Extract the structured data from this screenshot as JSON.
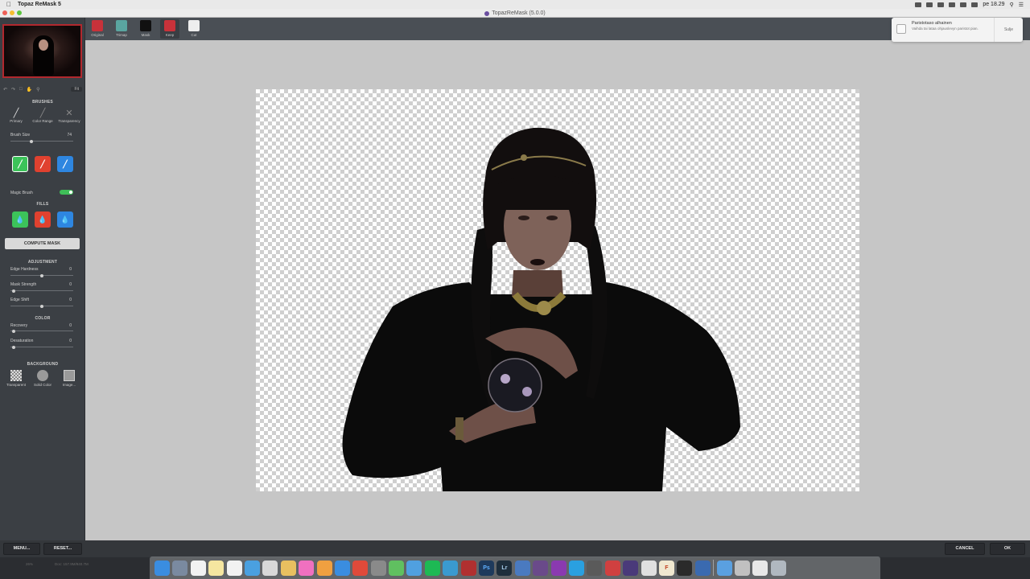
{
  "app": {
    "menu_name": "Topaz ReMask 5",
    "window_title": "TopazReMask (5.0.0)",
    "clock": "pe 18.29"
  },
  "views": [
    {
      "label": "Original",
      "color": "#c8323a"
    },
    {
      "label": "Trimap",
      "color": "#5aa5a0"
    },
    {
      "label": "Mask",
      "color": "#111111"
    },
    {
      "label": "Keep",
      "color": "#c8323a"
    },
    {
      "label": "Cut",
      "color": "#eeeeee"
    }
  ],
  "nav": {
    "fit_label": "Fit"
  },
  "brushes": {
    "heading": "BRUSHES",
    "tools": [
      "Primary",
      "Color Range",
      "Transparency"
    ],
    "size_label": "Brush Size",
    "size_value": "74",
    "size_fraction": 0.33,
    "color_buttons": [
      "#3cc35a",
      "#e0412f",
      "#2e86e0"
    ],
    "magic_label": "Magic Brush",
    "magic_on": true
  },
  "fills": {
    "heading": "FILLS",
    "buttons": [
      "#3cc35a",
      "#e0412f",
      "#2e86e0"
    ]
  },
  "compute_label": "COMPUTE MASK",
  "adjustment": {
    "heading": "ADJUSTMENT",
    "edge_hardness": {
      "label": "Edge Hardness",
      "value": "0",
      "fraction": 0.5
    },
    "mask_strength": {
      "label": "Mask Strength",
      "value": "0",
      "fraction": 0.05
    },
    "edge_shift": {
      "label": "Edge Shift",
      "value": "0",
      "fraction": 0.5
    }
  },
  "color": {
    "heading": "COLOR",
    "recovery": {
      "label": "Recovery",
      "value": "0",
      "fraction": 0.05
    },
    "desaturation": {
      "label": "Desaturation",
      "value": "0",
      "fraction": 0.05
    }
  },
  "background": {
    "heading": "BACKGROUND",
    "options": [
      "Transparent",
      "Solid Color",
      "Image..."
    ]
  },
  "notification": {
    "title": "Paristotaso alhainen",
    "body": "Vaihda tai lataa ohjauslevyn paristot pian.",
    "close": "Sulje"
  },
  "buttons": {
    "menu": "MENU...",
    "reset": "RESET...",
    "cancel": "CANCEL",
    "ok": "OK"
  },
  "status": {
    "zoom": "26%",
    "doc": "Doc: 157.9M/940.7M"
  },
  "dock_icons": [
    "finder-icon",
    "launchpad-icon",
    "calendar-icon",
    "notes-icon",
    "reminders-icon",
    "safari-icon",
    "mail-icon",
    "photos-icon",
    "itunes-icon",
    "books-icon",
    "appstore-icon",
    "chrome-icon",
    "system-prefs-icon",
    "messages-icon",
    "vpn-icon",
    "spotify-icon",
    "vectorize-icon",
    "remask-icon",
    "photoshop-icon",
    "lightroom-icon",
    "sync-icon",
    "studio-icon",
    "affinity-icon",
    "skype-icon",
    "keynote-icon",
    "pixelmator-icon",
    "vectornator-icon",
    "preview-icon",
    "font-icon",
    "gpu-icon",
    "quicktime-icon",
    "folder-icon",
    "downloads-icon",
    "documents-icon",
    "trash-icon"
  ]
}
